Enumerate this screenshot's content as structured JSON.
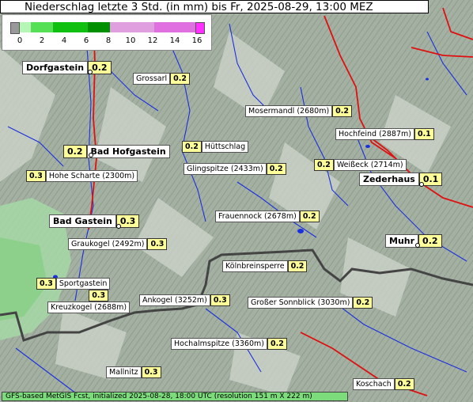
{
  "title": "Niederschlag letzte 3 Std. (in mm) bis Fr, 2025-08-29, 13:00 MEZ",
  "legend": {
    "ticks": [
      "0",
      "2",
      "4",
      "6",
      "8",
      "10",
      "12",
      "14",
      "16"
    ],
    "colors": [
      "#999999",
      "#b5f5b5",
      "#55e055",
      "#10c010",
      "#009000",
      "#e0a0e0",
      "#e070e0",
      "#ff30ff"
    ]
  },
  "places": [
    {
      "name": "Dorfgastein",
      "value": "0.2",
      "big": true
    },
    {
      "name": "Grossarl",
      "value": "0.2",
      "big": false
    },
    {
      "name": "Mosermandl (2680m)",
      "value": "0.2",
      "big": false
    },
    {
      "name": "Hochfeind (2887m)",
      "value": "0.1",
      "big": false
    },
    {
      "name": "Bad Hofgastein",
      "value": "0.2",
      "big": true
    },
    {
      "name": "Hüttschlag",
      "value": "0.2",
      "big": false
    },
    {
      "name": "Hohe Scharte (2300m)",
      "value": "0.3",
      "big": false
    },
    {
      "name": "Glingspitze (2433m)",
      "value": "0.2",
      "big": false
    },
    {
      "name": "Weißeck (2714m)",
      "value": "0.2",
      "big": false
    },
    {
      "name": "Zederhaus",
      "value": "0.1",
      "big": true
    },
    {
      "name": "Frauennock (2678m)",
      "value": "0.2",
      "big": false
    },
    {
      "name": "Bad Gastein",
      "value": "0.3",
      "big": true
    },
    {
      "name": "Muhr",
      "value": "0.2",
      "big": true
    },
    {
      "name": "Graukogel (2492m)",
      "value": "0.3",
      "big": false
    },
    {
      "name": "Kölnbreinsperre",
      "value": "0.2",
      "big": false
    },
    {
      "name": "Sportgastein",
      "value": "0.3",
      "big": false
    },
    {
      "name": "Kreuzkogel (2688m)",
      "value": "0.3",
      "big": false
    },
    {
      "name": "Ankogel (3252m)",
      "value": "0.3",
      "big": false
    },
    {
      "name": "Großer Sonnblick (3030m)",
      "value": "0.2",
      "big": false
    },
    {
      "name": "Hochalmspitze (3360m)",
      "value": "0.2",
      "big": false
    },
    {
      "name": "Mallnitz",
      "value": "0.3",
      "big": false
    },
    {
      "name": "Koschach",
      "value": "0.2",
      "big": false
    }
  ],
  "footer": "GFS-based MetGIS Fcst, initialized 2025-08-28, 18:00 UTC  (resolution 151 m X 222 m)"
}
